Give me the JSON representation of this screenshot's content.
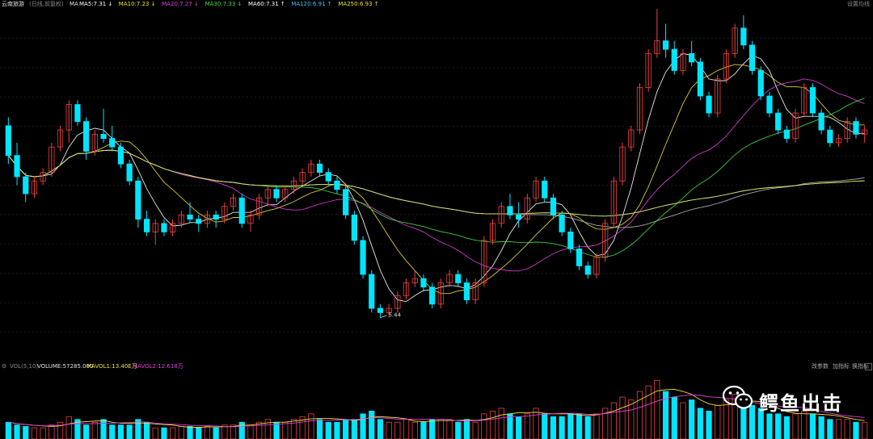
{
  "header": {
    "stock_name": "云南旅游",
    "period_info": "(日线,前复权)",
    "ma_label": "MA",
    "ma_items": [
      {
        "text": "MA5:7.31",
        "color": "#ffffff",
        "arrow": "↓"
      },
      {
        "text": "MA10:7.23",
        "color": "#f0e040",
        "arrow": "↓"
      },
      {
        "text": "MA20:7.27",
        "color": "#e040e0",
        "arrow": "↓"
      },
      {
        "text": "MA30:7.33",
        "color": "#40e040",
        "arrow": "↓"
      },
      {
        "text": "MA60:7.31",
        "color": "#ffffff",
        "arrow": "↑"
      },
      {
        "text": "MA120:6.91",
        "color": "#40c0ff",
        "arrow": "↑"
      },
      {
        "text": "MA250:6.93",
        "color": "#f0e040",
        "arrow": "↑"
      }
    ],
    "settings_label": "设置均线"
  },
  "volume_header": {
    "vol_label": "VOL(5,10)",
    "volume_text": "VOLUME:57285.000",
    "mavol1_text": "MAVOL1:13.40E万",
    "mavol2_text": "MAVOL2:12.618万",
    "buttons": [
      "改参数",
      "加指标",
      "换指标"
    ]
  },
  "watermark": {
    "text": "鳄鱼出击",
    "icon": "wechat-icon"
  },
  "colors": {
    "up": "#f04040",
    "down": "#00e5ff",
    "ma5": "#ffffff",
    "ma10": "#f0e040",
    "ma20": "#e040e0",
    "ma30": "#40e040",
    "ma60": "#bbbbbb",
    "ma120": "#40c0ff",
    "ma250": "#f0e040"
  },
  "chart_data": {
    "type": "candlestick",
    "ylim": [
      5.0,
      9.0
    ],
    "high_label": "9.28",
    "low_label": "5.44",
    "high_value": 9.28,
    "low_value": 5.44,
    "ohlc": [
      [
        7.7,
        7.8,
        7.25,
        7.35
      ],
      [
        7.35,
        7.5,
        7.0,
        7.1
      ],
      [
        7.1,
        7.15,
        6.8,
        6.9
      ],
      [
        6.9,
        7.1,
        6.85,
        7.05
      ],
      [
        7.05,
        7.2,
        7.0,
        7.15
      ],
      [
        7.15,
        7.5,
        7.1,
        7.45
      ],
      [
        7.45,
        7.7,
        7.4,
        7.65
      ],
      [
        7.65,
        8.0,
        7.5,
        7.95
      ],
      [
        7.95,
        8.0,
        7.7,
        7.75
      ],
      [
        7.75,
        7.8,
        7.3,
        7.4
      ],
      [
        7.4,
        7.65,
        7.35,
        7.6
      ],
      [
        7.6,
        7.9,
        7.5,
        7.55
      ],
      [
        7.55,
        7.7,
        7.4,
        7.45
      ],
      [
        7.45,
        7.5,
        7.2,
        7.25
      ],
      [
        7.25,
        7.3,
        7.0,
        7.05
      ],
      [
        7.05,
        7.1,
        6.5,
        6.6
      ],
      [
        6.6,
        6.7,
        6.4,
        6.45
      ],
      [
        6.45,
        6.6,
        6.3,
        6.55
      ],
      [
        6.55,
        6.6,
        6.4,
        6.45
      ],
      [
        6.45,
        6.6,
        6.4,
        6.55
      ],
      [
        6.55,
        6.7,
        6.5,
        6.65
      ],
      [
        6.65,
        6.8,
        6.55,
        6.6
      ],
      [
        6.6,
        6.65,
        6.45,
        6.55
      ],
      [
        6.55,
        6.7,
        6.5,
        6.65
      ],
      [
        6.65,
        6.7,
        6.5,
        6.6
      ],
      [
        6.6,
        6.8,
        6.55,
        6.75
      ],
      [
        6.75,
        6.9,
        6.7,
        6.85
      ],
      [
        6.85,
        6.9,
        6.5,
        6.55
      ],
      [
        6.55,
        6.7,
        6.45,
        6.65
      ],
      [
        6.65,
        6.9,
        6.6,
        6.85
      ],
      [
        6.85,
        7.0,
        6.75,
        6.95
      ],
      [
        6.95,
        7.0,
        6.8,
        6.85
      ],
      [
        6.85,
        7.0,
        6.8,
        6.95
      ],
      [
        6.95,
        7.1,
        6.9,
        7.05
      ],
      [
        7.05,
        7.2,
        7.0,
        7.15
      ],
      [
        7.15,
        7.3,
        7.1,
        7.25
      ],
      [
        7.25,
        7.3,
        7.1,
        7.15
      ],
      [
        7.15,
        7.2,
        7.0,
        7.05
      ],
      [
        7.05,
        7.1,
        6.9,
        6.95
      ],
      [
        6.95,
        7.0,
        6.6,
        6.65
      ],
      [
        6.65,
        6.7,
        6.3,
        6.35
      ],
      [
        6.35,
        6.4,
        5.9,
        5.95
      ],
      [
        5.95,
        6.0,
        5.5,
        5.55
      ],
      [
        5.55,
        5.6,
        5.44,
        5.5
      ],
      [
        5.5,
        5.6,
        5.45,
        5.55
      ],
      [
        5.55,
        5.75,
        5.5,
        5.7
      ],
      [
        5.7,
        5.9,
        5.65,
        5.85
      ],
      [
        5.85,
        6.0,
        5.8,
        5.9
      ],
      [
        5.9,
        5.95,
        5.75,
        5.8
      ],
      [
        5.8,
        5.85,
        5.55,
        5.6
      ],
      [
        5.6,
        5.9,
        5.55,
        5.85
      ],
      [
        5.85,
        6.0,
        5.8,
        5.95
      ],
      [
        5.95,
        6.0,
        5.8,
        5.85
      ],
      [
        5.85,
        5.9,
        5.6,
        5.65
      ],
      [
        5.65,
        5.9,
        5.6,
        5.85
      ],
      [
        5.85,
        6.4,
        5.8,
        6.35
      ],
      [
        6.35,
        6.6,
        6.3,
        6.55
      ],
      [
        6.55,
        6.8,
        6.5,
        6.75
      ],
      [
        6.75,
        6.9,
        6.6,
        6.65
      ],
      [
        6.65,
        6.8,
        6.5,
        6.6
      ],
      [
        6.6,
        6.9,
        6.55,
        6.85
      ],
      [
        6.85,
        7.1,
        6.8,
        7.05
      ],
      [
        7.05,
        7.1,
        6.8,
        6.85
      ],
      [
        6.85,
        6.9,
        6.6,
        6.65
      ],
      [
        6.65,
        6.7,
        6.4,
        6.45
      ],
      [
        6.45,
        6.5,
        6.2,
        6.25
      ],
      [
        6.25,
        6.3,
        6.0,
        6.05
      ],
      [
        6.05,
        6.1,
        5.9,
        5.95
      ],
      [
        5.95,
        6.2,
        5.9,
        6.15
      ],
      [
        6.15,
        6.6,
        6.1,
        6.55
      ],
      [
        6.55,
        7.1,
        6.5,
        7.05
      ],
      [
        7.05,
        7.5,
        7.0,
        7.45
      ],
      [
        7.45,
        7.7,
        7.4,
        7.65
      ],
      [
        7.65,
        8.2,
        7.6,
        8.15
      ],
      [
        8.15,
        8.6,
        8.1,
        8.55
      ],
      [
        8.55,
        9.28,
        8.5,
        8.7
      ],
      [
        8.7,
        8.9,
        8.5,
        8.6
      ],
      [
        8.6,
        8.7,
        8.3,
        8.35
      ],
      [
        8.35,
        8.6,
        8.3,
        8.55
      ],
      [
        8.55,
        8.7,
        8.4,
        8.45
      ],
      [
        8.45,
        8.5,
        8.0,
        8.05
      ],
      [
        8.05,
        8.1,
        7.8,
        7.85
      ],
      [
        7.85,
        8.3,
        7.8,
        8.25
      ],
      [
        8.25,
        8.6,
        8.2,
        8.55
      ],
      [
        8.55,
        8.9,
        8.5,
        8.85
      ],
      [
        8.85,
        9.0,
        8.6,
        8.65
      ],
      [
        8.65,
        8.7,
        8.3,
        8.35
      ],
      [
        8.35,
        8.4,
        8.0,
        8.05
      ],
      [
        8.05,
        8.1,
        7.8,
        7.85
      ],
      [
        7.85,
        7.9,
        7.6,
        7.65
      ],
      [
        7.65,
        7.7,
        7.5,
        7.55
      ],
      [
        7.55,
        7.9,
        7.5,
        7.85
      ],
      [
        7.85,
        8.2,
        7.8,
        8.15
      ],
      [
        8.15,
        8.2,
        7.8,
        7.85
      ],
      [
        7.85,
        7.9,
        7.6,
        7.65
      ],
      [
        7.65,
        7.7,
        7.45,
        7.5
      ],
      [
        7.5,
        7.6,
        7.45,
        7.55
      ],
      [
        7.55,
        7.8,
        7.5,
        7.75
      ],
      [
        7.75,
        7.8,
        7.55,
        7.6
      ],
      [
        7.6,
        7.7,
        7.5,
        7.65
      ]
    ],
    "volumes": [
      6,
      5,
      4.5,
      4,
      4,
      5,
      6,
      8,
      7,
      5,
      6,
      7,
      5,
      5,
      5,
      7,
      6,
      4,
      4,
      4,
      4.5,
      4.5,
      4,
      4.5,
      4,
      5,
      5,
      6,
      5,
      6,
      7,
      6,
      6,
      7,
      8,
      9,
      7,
      6,
      6,
      7,
      7,
      9,
      10,
      7,
      6,
      6,
      7,
      6,
      6,
      7,
      7,
      7,
      6,
      7,
      6,
      9,
      10,
      11,
      9,
      8,
      9,
      11,
      9,
      8,
      8,
      9,
      9,
      8,
      9,
      11,
      13,
      15,
      14,
      17,
      19,
      21,
      17,
      15,
      13,
      14,
      11,
      10,
      12,
      14,
      16,
      14,
      12,
      11,
      9,
      9,
      8,
      9,
      10,
      9,
      8,
      7,
      7,
      7,
      6,
      6
    ]
  }
}
